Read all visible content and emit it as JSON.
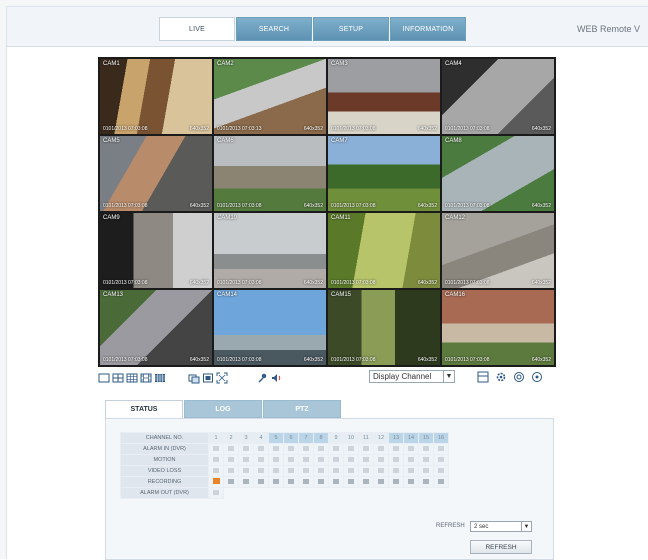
{
  "nav": {
    "tabs": [
      {
        "label": "LIVE",
        "active": true
      },
      {
        "label": "SEARCH",
        "active": false
      },
      {
        "label": "SETUP",
        "active": false
      },
      {
        "label": "INFORMATION",
        "active": false
      }
    ],
    "brand": "WEB Remote V"
  },
  "cameras": [
    {
      "name": "CAM1",
      "ts": "0101/2013 07:03:08",
      "res": "640x352",
      "scene": "room"
    },
    {
      "name": "CAM2",
      "ts": "0101/2013 07:03:13",
      "res": "640x352",
      "scene": "path"
    },
    {
      "name": "CAM3",
      "ts": "0101/2013 07:03:08",
      "res": "640x352",
      "scene": "lobby"
    },
    {
      "name": "CAM4",
      "ts": "0101/2013 07:03:08",
      "res": "640x352",
      "scene": "alley"
    },
    {
      "name": "CAM5",
      "ts": "0101/2013 07:03:08",
      "res": "640x352",
      "scene": "stairs"
    },
    {
      "name": "CAM6",
      "ts": "0101/2013 07:03:08",
      "res": "640x352",
      "scene": "patio"
    },
    {
      "name": "CAM7",
      "ts": "0101/2013 07:03:08",
      "res": "640x352",
      "scene": "lawn"
    },
    {
      "name": "CAM8",
      "ts": "0101/2013 07:03:08",
      "res": "640x352",
      "scene": "walkway"
    },
    {
      "name": "CAM9",
      "ts": "0101/2013 07:03:08",
      "res": "640x352",
      "scene": "corridor"
    },
    {
      "name": "CAM10",
      "ts": "0101/2013 07:03:08",
      "res": "640x352",
      "scene": "fence"
    },
    {
      "name": "CAM11",
      "ts": "0101/2013 07:03:08",
      "res": "640x352",
      "scene": "greenroom"
    },
    {
      "name": "CAM12",
      "ts": "0101/2013 07:03:08",
      "res": "640x352",
      "scene": "ramp"
    },
    {
      "name": "CAM13",
      "ts": "0101/2013 07:03:08",
      "res": "640x352",
      "scene": "courtyard"
    },
    {
      "name": "CAM14",
      "ts": "0101/2013 07:03:08",
      "res": "640x352",
      "scene": "sky"
    },
    {
      "name": "CAM15",
      "ts": "0101/2013 07:03:08",
      "res": "640x352",
      "scene": "doorway"
    },
    {
      "name": "CAM16",
      "ts": "0101/2013 07:03:08",
      "res": "640x352",
      "scene": "building"
    }
  ],
  "toolbar": {
    "layout_icons": [
      "single-view-icon",
      "quad-view-icon",
      "nine-view-icon",
      "thirteen-view-icon",
      "sixteen-view-icon"
    ],
    "action_icons": [
      "capture-icon",
      "record-icon",
      "fullscreen-icon"
    ],
    "ptz_icons": [
      "microphone-icon",
      "audio-icon"
    ],
    "channel_select": "Display Channel",
    "right_icons": [
      "grid-icon",
      "settings-icon",
      "zoom-icon",
      "help-icon"
    ]
  },
  "panel": {
    "tabs": [
      {
        "label": "STATUS",
        "active": true
      },
      {
        "label": "LOG",
        "active": false
      },
      {
        "label": "PTZ",
        "active": false
      }
    ],
    "rows": [
      "CHANNEL NO.",
      "ALARM IN (DVR)",
      "MOTION",
      "VIDEO LOSS",
      "RECORDING",
      "ALARM OUT (DVR)"
    ],
    "channels": [
      "1",
      "2",
      "3",
      "4",
      "5",
      "6",
      "7",
      "8",
      "9",
      "10",
      "11",
      "12",
      "13",
      "14",
      "15",
      "16"
    ],
    "refresh_label": "REFRESH",
    "refresh_value": "2 sec",
    "refresh_button": "REFRESH"
  },
  "colors": {
    "tab_blue": "#6a9dbd",
    "recording_orange": "#e8842a",
    "panel_bg": "#f3f7fa"
  }
}
